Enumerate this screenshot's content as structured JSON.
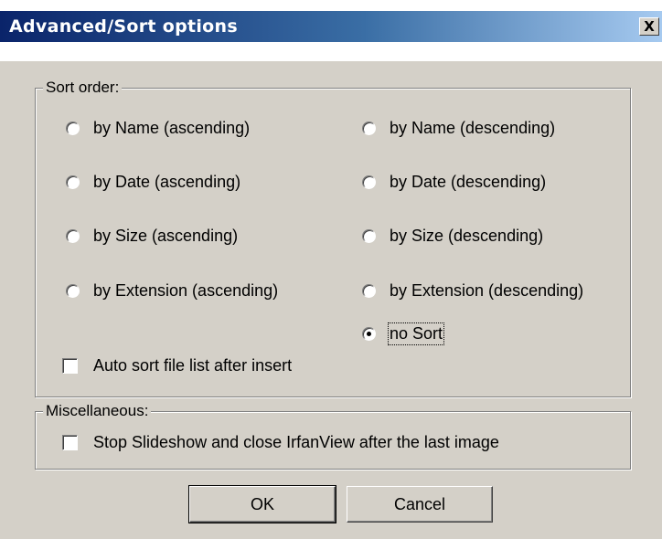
{
  "window": {
    "title": "Advanced/Sort options",
    "close_glyph": "X"
  },
  "sort_order": {
    "title": "Sort order:",
    "options": [
      {
        "label": "by Name (ascending)",
        "checked": false
      },
      {
        "label": "by Name (descending)",
        "checked": false
      },
      {
        "label": "by Date (ascending)",
        "checked": false
      },
      {
        "label": "by Date (descending)",
        "checked": false
      },
      {
        "label": "by Size (ascending)",
        "checked": false
      },
      {
        "label": "by Size (descending)",
        "checked": false
      },
      {
        "label": "by Extension (ascending)",
        "checked": false
      },
      {
        "label": "by Extension (descending)",
        "checked": false
      },
      {
        "label": "no Sort",
        "checked": true
      }
    ],
    "auto_sort": {
      "label": "Auto sort file list after insert",
      "checked": false
    }
  },
  "misc": {
    "title": "Miscellaneous:",
    "stop_slideshow": {
      "label": "Stop Slideshow and close IrfanView after the last image",
      "checked": false
    }
  },
  "buttons": {
    "ok": "OK",
    "cancel": "Cancel"
  }
}
